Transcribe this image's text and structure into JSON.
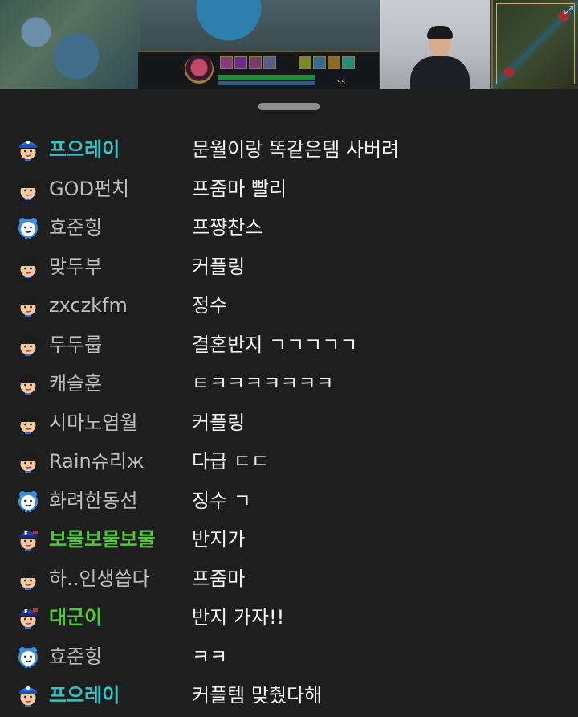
{
  "stream": {
    "hud_gold": "55"
  },
  "chat": {
    "messages": [
      {
        "nick": "프으레이",
        "text": "문월이랑 똑같은템 사버려",
        "nick_color": "#3fc1c4",
        "badge": "manager",
        "bold": true
      },
      {
        "nick": "GOD펀치",
        "text": "프줌마 빨리",
        "nick_color": "#bdbdbd",
        "badge": "fan",
        "bold": false
      },
      {
        "nick": "효준힝",
        "text": "프쨩찬스",
        "nick_color": "#bdbdbd",
        "badge": "clock",
        "bold": false
      },
      {
        "nick": "맞두부",
        "text": "커플링",
        "nick_color": "#bdbdbd",
        "badge": "fan",
        "bold": false
      },
      {
        "nick": "zxczkfm",
        "text": "정수",
        "nick_color": "#bdbdbd",
        "badge": "fan",
        "bold": false
      },
      {
        "nick": "두두룹",
        "text": "결혼반지 ㄱㄱㄱㄱㄱ",
        "nick_color": "#bdbdbd",
        "badge": "fan",
        "bold": false
      },
      {
        "nick": "캐슬훈",
        "text": "ㅌㅋㅋㅋㅋㅋㅋㅋ",
        "nick_color": "#bdbdbd",
        "badge": "fan",
        "bold": false
      },
      {
        "nick": "시마노염월",
        "text": "커플링",
        "nick_color": "#bdbdbd",
        "badge": "fan",
        "bold": false
      },
      {
        "nick": "Rain슈리ж",
        "text": "다급 ㄷㄷ",
        "nick_color": "#bdbdbd",
        "badge": "fan",
        "bold": false
      },
      {
        "nick": "화려한동선",
        "text": "징수 ㄱ",
        "nick_color": "#bdbdbd",
        "badge": "clock",
        "bold": false
      },
      {
        "nick": "보물보물보물",
        "text": "반지가",
        "nick_color": "#53c63d",
        "badge": "subscriber",
        "bold": true
      },
      {
        "nick": "하..인생씁다",
        "text": "프줌마",
        "nick_color": "#bdbdbd",
        "badge": "fan",
        "bold": false
      },
      {
        "nick": "대군이",
        "text": "반지 가자!!",
        "nick_color": "#53c63d",
        "badge": "subscriber",
        "bold": true
      },
      {
        "nick": "효준힝",
        "text": "ㅋㅋ",
        "nick_color": "#bdbdbd",
        "badge": "clock",
        "bold": false
      },
      {
        "nick": "프으레이",
        "text": "커플템 맞췄다해",
        "nick_color": "#3fc1c4",
        "badge": "manager",
        "bold": true
      }
    ]
  },
  "colors": {
    "background": "#1e1e1e",
    "message_text": "#f2f2f2",
    "default_nick": "#bdbdbd",
    "manager_nick": "#3fc1c4",
    "subscriber_nick": "#53c63d"
  }
}
